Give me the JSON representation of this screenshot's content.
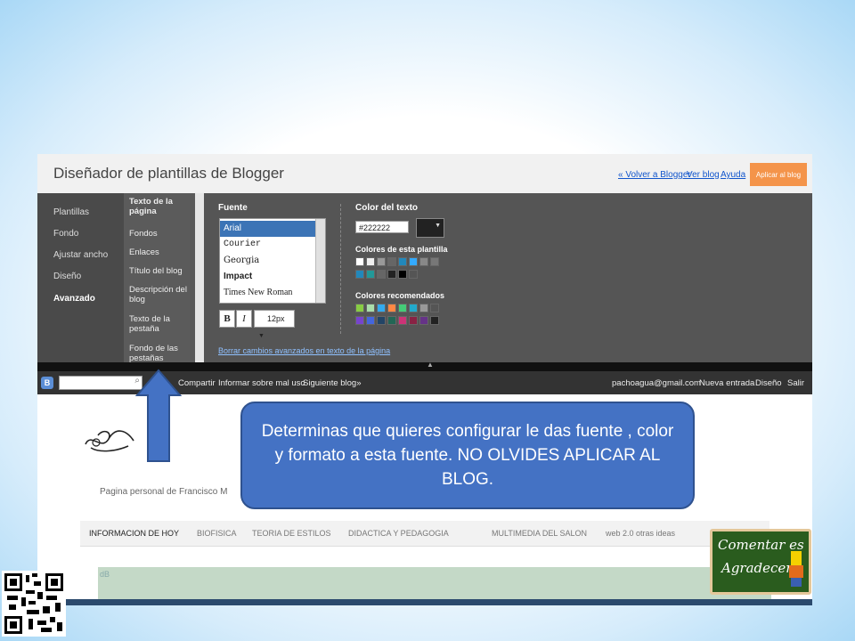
{
  "header": {
    "title": "Diseñador de plantillas de Blogger",
    "back_link": "« Volver a Blogger",
    "view_blog": "Ver blog",
    "help": "Ayuda",
    "apply": "Aplicar al blog"
  },
  "nav_primary": [
    "Plantillas",
    "Fondo",
    "Ajustar ancho",
    "Diseño",
    "Avanzado"
  ],
  "nav_secondary": [
    "Texto de la página",
    "Fondos",
    "Enlaces",
    "Título del blog",
    "Descripción del blog",
    "Texto de la pestaña",
    "Fondo de las pestañas"
  ],
  "font_section": {
    "label": "Fuente",
    "options": [
      "Arial",
      "Courier",
      "Georgia",
      "Impact",
      "Times New Roman"
    ],
    "selected": "Arial",
    "bold": "B",
    "italic": "I",
    "size": "12px"
  },
  "color_section": {
    "label": "Color del texto",
    "value": "#222222",
    "template_colors_label": "Colores de esta plantilla",
    "recommended_label": "Colores recomendados",
    "template_colors": [
      "#ffffff",
      "#eeeeee",
      "#999999",
      "#666666",
      "#2288bb",
      "#33aaff",
      "#888888",
      "#777777",
      "#2288bb",
      "#229999",
      "#666666",
      "#222222",
      "#000000",
      "#555555"
    ],
    "recommended_colors": [
      "#88cc44",
      "#aaddaa",
      "#33aaee",
      "#ff8844",
      "#44cc77",
      "#22aacc",
      "#999999",
      "#555555",
      "#7744cc",
      "#4466dd",
      "#224466",
      "#226655",
      "#cc3377",
      "#882244",
      "#663388",
      "#222222"
    ]
  },
  "reset_link": "Borrar cambios avanzados en texto de la página",
  "blogger_bar": {
    "logo": "B",
    "links": [
      "Compartir",
      "Informar sobre mal uso",
      "Siguiente blog»"
    ],
    "user": "pachoagua@gmail.com",
    "right_links": [
      "Nueva entrada",
      "Diseño",
      "Salir"
    ]
  },
  "blog": {
    "subtitle": "Pagina personal de Francisco M",
    "tabs": [
      "INFORMACION DE HOY",
      "BIOFISICA",
      "TEORIA DE ESTILOS",
      "DIDACTICA Y PEDAGOGIA",
      "MULTIMEDIA DEL SALON",
      "web 2.0 otras ideas"
    ],
    "active_tab": "INFORMACION DE HOY",
    "banner_text": "dB"
  },
  "callout": {
    "text": "Determinas que quieres configurar le das fuente , color  y formato a esta  fuente. NO OLVIDES APLICAR AL BLOG."
  },
  "stamp": {
    "line1": "Comentar es",
    "line2": "Agradecer"
  },
  "colors": {
    "accent": "#4472c4",
    "apply_button": "#f4944a",
    "panel": "#555555"
  }
}
